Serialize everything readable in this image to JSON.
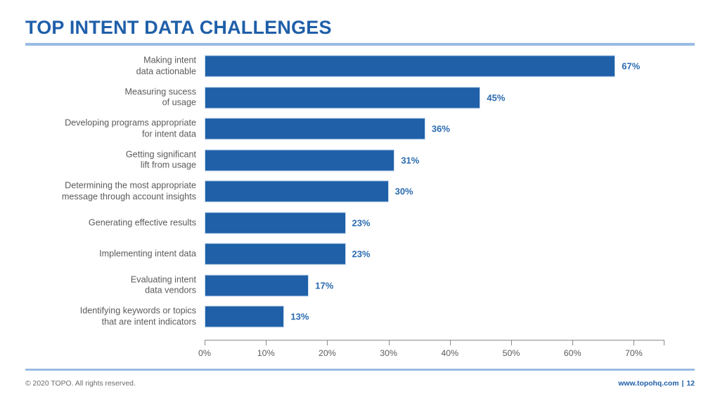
{
  "slide": {
    "title": "TOP INTENT DATA CHALLENGES",
    "accent_color": "#1F5FA9",
    "rule_color": "#9ABBE4",
    "bar_color": "#1F60A8",
    "value_label_color": "#2A6BB0",
    "category_label_color": "#5B5B5B"
  },
  "footer": {
    "copyright": "© 2020 TOPO. All rights reserved.",
    "website": "www.topohq.com",
    "separator": "|",
    "page_number": "12"
  },
  "chart_data": {
    "type": "bar",
    "orientation": "horizontal",
    "title": "TOP INTENT DATA CHALLENGES",
    "xlabel": "",
    "ylabel": "",
    "xlim": [
      0,
      70
    ],
    "grid": false,
    "legend": null,
    "axis_max_display": 75,
    "tick_labels": [
      "0%",
      "10%",
      "20%",
      "30%",
      "40%",
      "50%",
      "60%",
      "70%"
    ],
    "tick_values": [
      0,
      10,
      20,
      30,
      40,
      50,
      60,
      70
    ],
    "categories": [
      "Making intent\ndata actionable",
      "Measuring sucess\nof usage",
      "Developing programs appropriate\nfor intent data",
      "Getting significant\nlift from usage",
      "Determining the most appropriate\nmessage through account insights",
      "Generating effective results",
      "Implementing intent data",
      "Evaluating intent\ndata vendors",
      "Identifying keywords or topics\nthat are intent indicators"
    ],
    "values": [
      67,
      45,
      36,
      31,
      30,
      23,
      23,
      17,
      13
    ],
    "value_labels": [
      "67%",
      "45%",
      "36%",
      "31%",
      "30%",
      "23%",
      "23%",
      "17%",
      "13%"
    ]
  }
}
